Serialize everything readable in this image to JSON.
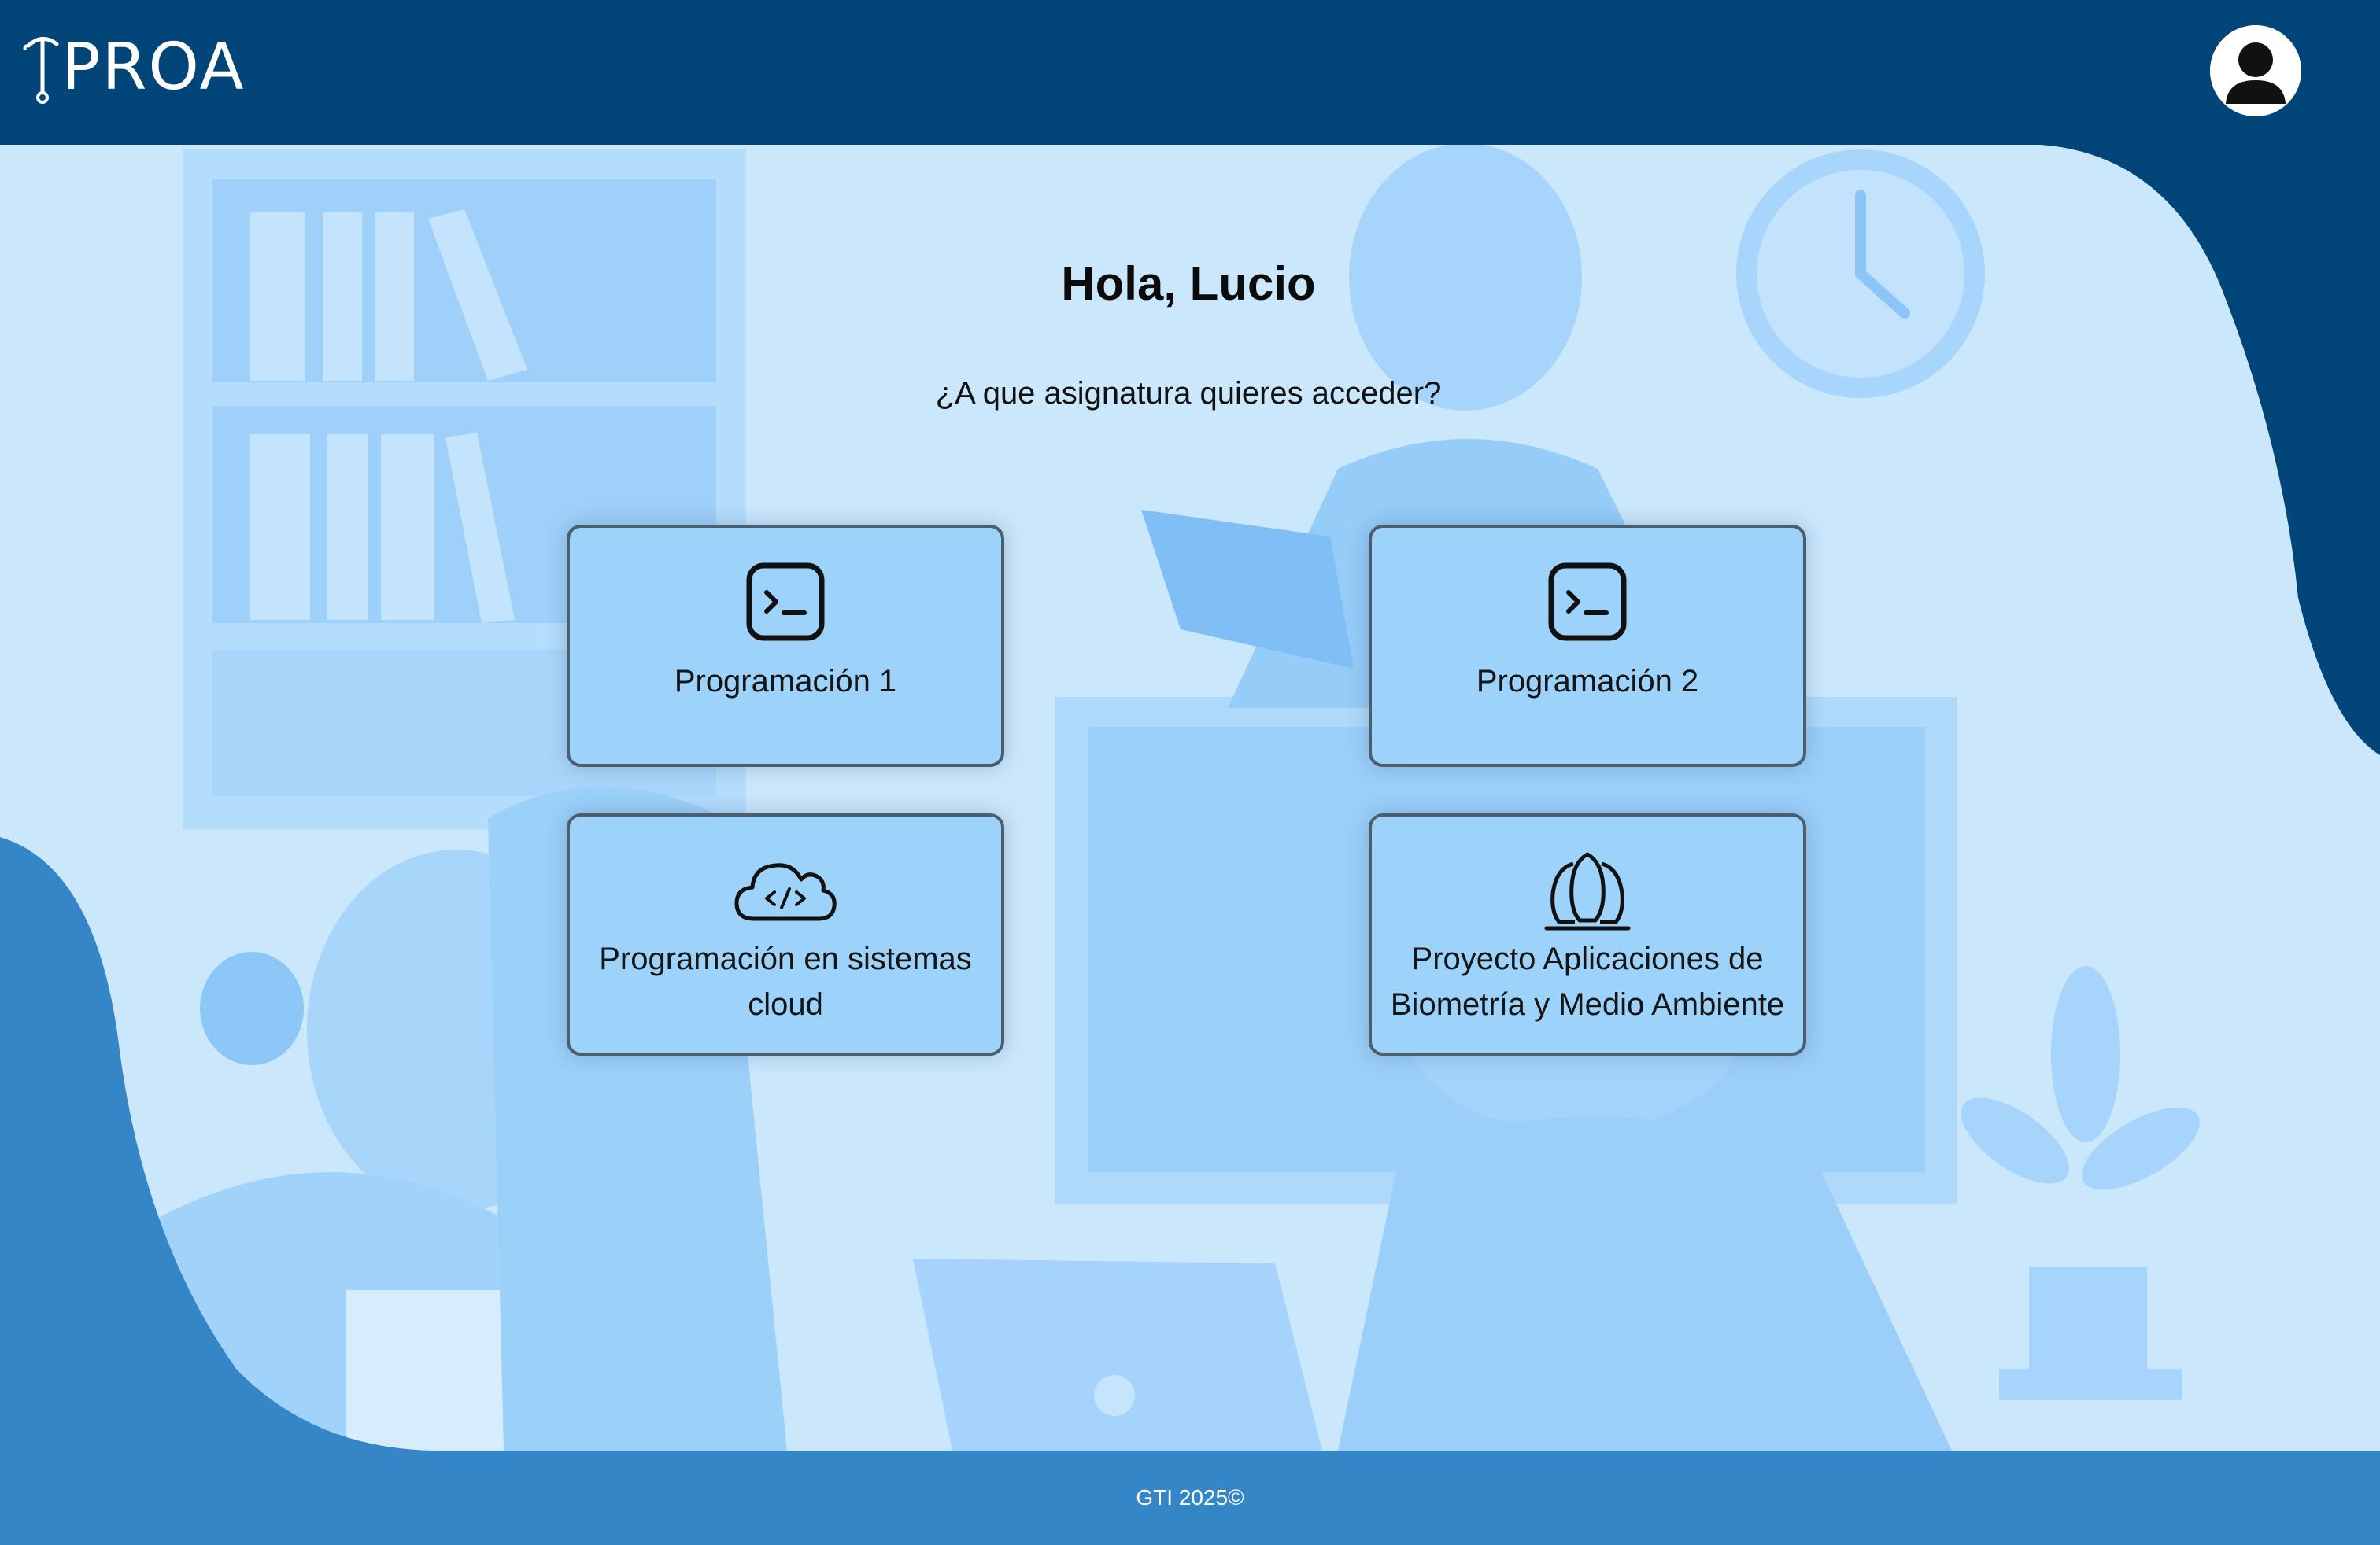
{
  "header": {
    "logo_text": "PROA",
    "avatar_icon": "user-avatar-icon"
  },
  "main": {
    "greeting": "Hola, Lucio",
    "question": "¿A que asignatura quieres acceder?"
  },
  "subjects": [
    {
      "label": "Programación 1",
      "icon": "terminal-icon"
    },
    {
      "label": "Programación 2",
      "icon": "terminal-icon"
    },
    {
      "label": "Programación en sistemas cloud",
      "icon": "cloud-code-icon"
    },
    {
      "label": "Proyecto Aplicaciones de Biometría y Medio Ambiente",
      "icon": "lungs-icon"
    }
  ],
  "footer": {
    "copyright": "GTI 2025©"
  },
  "colors": {
    "header": "#024679",
    "background": "#cbe7fc",
    "card": "#9dd2fb",
    "footer": "#3486c7"
  }
}
